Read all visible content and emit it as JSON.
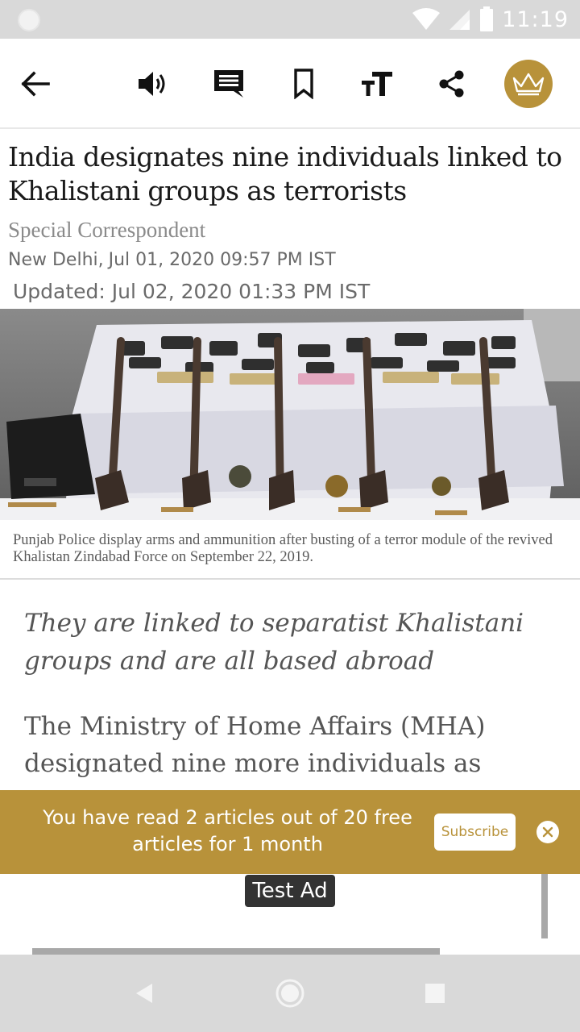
{
  "status_bar": {
    "time": "11:19",
    "icons": [
      "notification-dot-icon",
      "wifi-icon",
      "signal-icon",
      "battery-icon"
    ]
  },
  "toolbar": {
    "icons": [
      "back-arrow-icon",
      "speaker-icon",
      "comment-icon",
      "bookmark-icon",
      "text-size-icon",
      "share-icon",
      "crown-icon"
    ],
    "accent_color": "#b8923a"
  },
  "article": {
    "headline": "India designates nine individuals linked to Khalistani groups as terrorists",
    "byline": "Special Correspondent",
    "location": "New Delhi,",
    "published": "Jul 01, 2020 09:57 PM IST",
    "updated": "Updated: Jul 02, 2020 01:33 PM IST",
    "photo_caption": "Punjab Police display arms and ammunition after busting of a terror module of the revived Khalistan Zindabad Force on September 22, 2019.",
    "standfirst": "They are linked to separatist Khalistani groups and are all based abroad",
    "body": "The Ministry of Home Affairs (MHA) designated nine more individuals as"
  },
  "paywall_banner": {
    "message": "You have read 2 articles out of 20 free articles for 1 month",
    "subscribe_label": "Subscribe",
    "background_color": "#b8923a"
  },
  "ad": {
    "label": "Test Ad"
  },
  "nav_bar": {
    "icons": [
      "back-triangle-icon",
      "home-circle-icon",
      "recents-square-icon"
    ]
  }
}
